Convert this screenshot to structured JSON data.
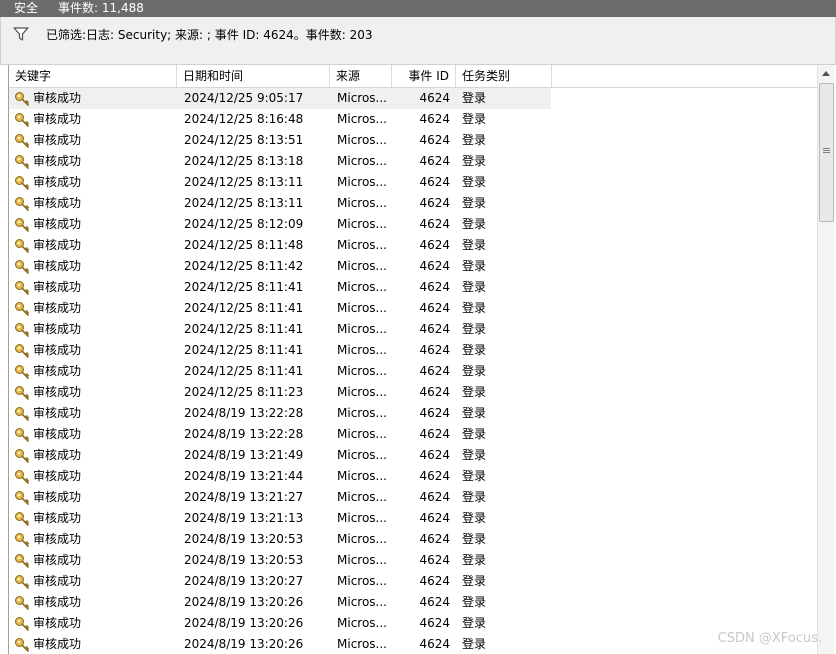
{
  "titlebar": {
    "log_name": "安全",
    "event_count": "事件数: 11,488"
  },
  "filter": {
    "icon": "funnel-icon",
    "text": "已筛选:日志: Security; 来源: ; 事件 ID: 4624。事件数: 203"
  },
  "columns": {
    "keyword": "关键字",
    "datetime": "日期和时间",
    "source": "来源",
    "event_id": "事件 ID",
    "category": "任务类别"
  },
  "rows": [
    {
      "keyword": "审核成功",
      "datetime": "2024/12/25 9:05:17",
      "source": "Micros...",
      "event_id": "4624",
      "category": "登录"
    },
    {
      "keyword": "审核成功",
      "datetime": "2024/12/25 8:16:48",
      "source": "Micros...",
      "event_id": "4624",
      "category": "登录"
    },
    {
      "keyword": "审核成功",
      "datetime": "2024/12/25 8:13:51",
      "source": "Micros...",
      "event_id": "4624",
      "category": "登录"
    },
    {
      "keyword": "审核成功",
      "datetime": "2024/12/25 8:13:18",
      "source": "Micros...",
      "event_id": "4624",
      "category": "登录"
    },
    {
      "keyword": "审核成功",
      "datetime": "2024/12/25 8:13:11",
      "source": "Micros...",
      "event_id": "4624",
      "category": "登录"
    },
    {
      "keyword": "审核成功",
      "datetime": "2024/12/25 8:13:11",
      "source": "Micros...",
      "event_id": "4624",
      "category": "登录"
    },
    {
      "keyword": "审核成功",
      "datetime": "2024/12/25 8:12:09",
      "source": "Micros...",
      "event_id": "4624",
      "category": "登录"
    },
    {
      "keyword": "审核成功",
      "datetime": "2024/12/25 8:11:48",
      "source": "Micros...",
      "event_id": "4624",
      "category": "登录"
    },
    {
      "keyword": "审核成功",
      "datetime": "2024/12/25 8:11:42",
      "source": "Micros...",
      "event_id": "4624",
      "category": "登录"
    },
    {
      "keyword": "审核成功",
      "datetime": "2024/12/25 8:11:41",
      "source": "Micros...",
      "event_id": "4624",
      "category": "登录"
    },
    {
      "keyword": "审核成功",
      "datetime": "2024/12/25 8:11:41",
      "source": "Micros...",
      "event_id": "4624",
      "category": "登录"
    },
    {
      "keyword": "审核成功",
      "datetime": "2024/12/25 8:11:41",
      "source": "Micros...",
      "event_id": "4624",
      "category": "登录"
    },
    {
      "keyword": "审核成功",
      "datetime": "2024/12/25 8:11:41",
      "source": "Micros...",
      "event_id": "4624",
      "category": "登录"
    },
    {
      "keyword": "审核成功",
      "datetime": "2024/12/25 8:11:41",
      "source": "Micros...",
      "event_id": "4624",
      "category": "登录"
    },
    {
      "keyword": "审核成功",
      "datetime": "2024/12/25 8:11:23",
      "source": "Micros...",
      "event_id": "4624",
      "category": "登录"
    },
    {
      "keyword": "审核成功",
      "datetime": "2024/8/19 13:22:28",
      "source": "Micros...",
      "event_id": "4624",
      "category": "登录"
    },
    {
      "keyword": "审核成功",
      "datetime": "2024/8/19 13:22:28",
      "source": "Micros...",
      "event_id": "4624",
      "category": "登录"
    },
    {
      "keyword": "审核成功",
      "datetime": "2024/8/19 13:21:49",
      "source": "Micros...",
      "event_id": "4624",
      "category": "登录"
    },
    {
      "keyword": "审核成功",
      "datetime": "2024/8/19 13:21:44",
      "source": "Micros...",
      "event_id": "4624",
      "category": "登录"
    },
    {
      "keyword": "审核成功",
      "datetime": "2024/8/19 13:21:27",
      "source": "Micros...",
      "event_id": "4624",
      "category": "登录"
    },
    {
      "keyword": "审核成功",
      "datetime": "2024/8/19 13:21:13",
      "source": "Micros...",
      "event_id": "4624",
      "category": "登录"
    },
    {
      "keyword": "审核成功",
      "datetime": "2024/8/19 13:20:53",
      "source": "Micros...",
      "event_id": "4624",
      "category": "登录"
    },
    {
      "keyword": "审核成功",
      "datetime": "2024/8/19 13:20:53",
      "source": "Micros...",
      "event_id": "4624",
      "category": "登录"
    },
    {
      "keyword": "审核成功",
      "datetime": "2024/8/19 13:20:27",
      "source": "Micros...",
      "event_id": "4624",
      "category": "登录"
    },
    {
      "keyword": "审核成功",
      "datetime": "2024/8/19 13:20:26",
      "source": "Micros...",
      "event_id": "4624",
      "category": "登录"
    },
    {
      "keyword": "审核成功",
      "datetime": "2024/8/19 13:20:26",
      "source": "Micros...",
      "event_id": "4624",
      "category": "登录"
    },
    {
      "keyword": "审核成功",
      "datetime": "2024/8/19 13:20:26",
      "source": "Micros...",
      "event_id": "4624",
      "category": "登录"
    }
  ],
  "row_icon": "key-icon",
  "watermark": "CSDN @XFocus."
}
